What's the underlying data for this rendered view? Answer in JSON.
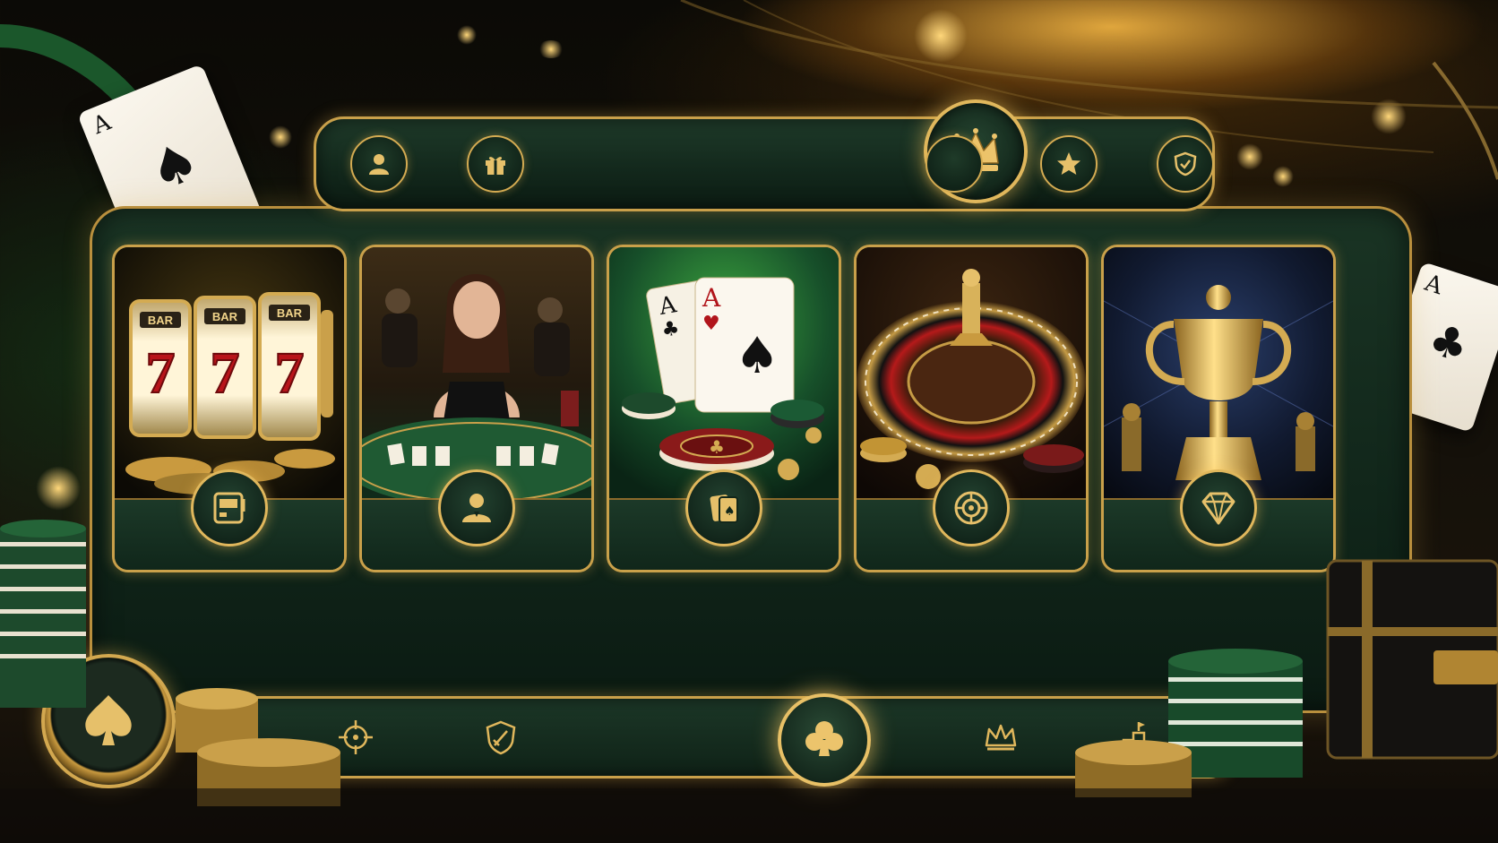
{
  "header": {
    "left_icons": [
      {
        "name": "user-icon"
      },
      {
        "name": "gift-icon"
      }
    ],
    "center_icon": "crown-icon",
    "right_icons": [
      {
        "name": "star-icon"
      },
      {
        "name": "shield-icon"
      }
    ]
  },
  "game_cards": [
    {
      "category": "slots",
      "reel_label": "BAR",
      "reel_symbol": "7",
      "button_icon": "slot-machine-icon"
    },
    {
      "category": "live-dealer",
      "button_icon": "dealer-icon"
    },
    {
      "category": "poker",
      "card_rank": "A",
      "button_icon": "cards-icon"
    },
    {
      "category": "roulette",
      "button_icon": "roulette-wheel-icon"
    },
    {
      "category": "tournaments",
      "button_icon": "diamond-icon"
    }
  ],
  "footer": {
    "icons": [
      {
        "name": "target-icon"
      },
      {
        "name": "shield-sword-icon"
      },
      {
        "name": "club-icon"
      },
      {
        "name": "crown-icon"
      },
      {
        "name": "podium-icon"
      }
    ]
  },
  "decor": {
    "left_card_rank": "A",
    "right_card_rank": "A",
    "accent_gold": "#d4ab52",
    "panel_green": "#12271b"
  }
}
